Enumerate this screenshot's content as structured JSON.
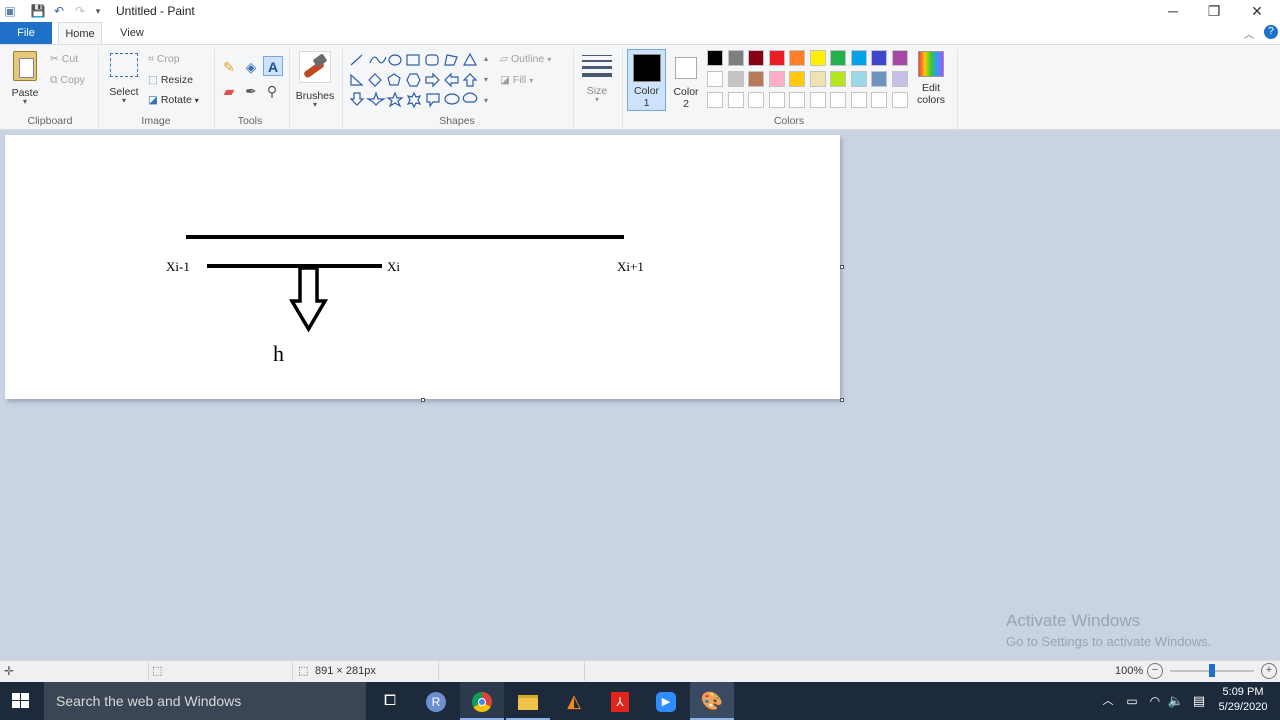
{
  "window": {
    "title": "Untitled - Paint",
    "controls": {
      "minimize": "─",
      "restore": "❐",
      "close": "✕"
    }
  },
  "tabs": [
    "File",
    "Home",
    "View"
  ],
  "ribbon": {
    "clipboard": {
      "paste": "Paste",
      "cut": "Cut",
      "copy": "Copy",
      "label": "Clipboard"
    },
    "image": {
      "select": "Select",
      "crop": "Crop",
      "resize": "Resize",
      "rotate": "Rotate",
      "label": "Image"
    },
    "tools": {
      "label": "Tools"
    },
    "brushes": {
      "label": "Brushes"
    },
    "shapes": {
      "outline": "Outline",
      "fill": "Fill",
      "label": "Shapes"
    },
    "size": {
      "label": "Size"
    },
    "color1": {
      "line1": "Color",
      "line2": "1"
    },
    "color2": {
      "line1": "Color",
      "line2": "2"
    },
    "colors": {
      "label": "Colors",
      "edit_line1": "Edit",
      "edit_line2": "colors",
      "row1": [
        "#000000",
        "#7f7f7f",
        "#880015",
        "#ed1c24",
        "#ff7f27",
        "#fff200",
        "#22b14c",
        "#00a2e8",
        "#3f48cc",
        "#a349a4"
      ],
      "row2": [
        "#ffffff",
        "#c3c3c3",
        "#b97a57",
        "#ffaec9",
        "#ffc90e",
        "#efe4b0",
        "#b5e61d",
        "#99d9ea",
        "#7092be",
        "#c8bfe7"
      ],
      "row3": [
        "#ffffff",
        "#ffffff",
        "#ffffff",
        "#ffffff",
        "#ffffff",
        "#ffffff",
        "#ffffff",
        "#ffffff",
        "#ffffff",
        "#ffffff"
      ]
    }
  },
  "drawing": {
    "label_left": "Xi-1",
    "label_mid": "Xi",
    "label_right": "Xi+1",
    "label_h": "h"
  },
  "status": {
    "canvas_size": "891 × 281px",
    "zoom": "100%"
  },
  "watermark": {
    "line1": "Activate Windows",
    "line2": "Go to Settings to activate Windows."
  },
  "taskbar": {
    "search_placeholder": "Search the web and Windows",
    "time": "5:09 PM",
    "date": "5/29/2020"
  }
}
